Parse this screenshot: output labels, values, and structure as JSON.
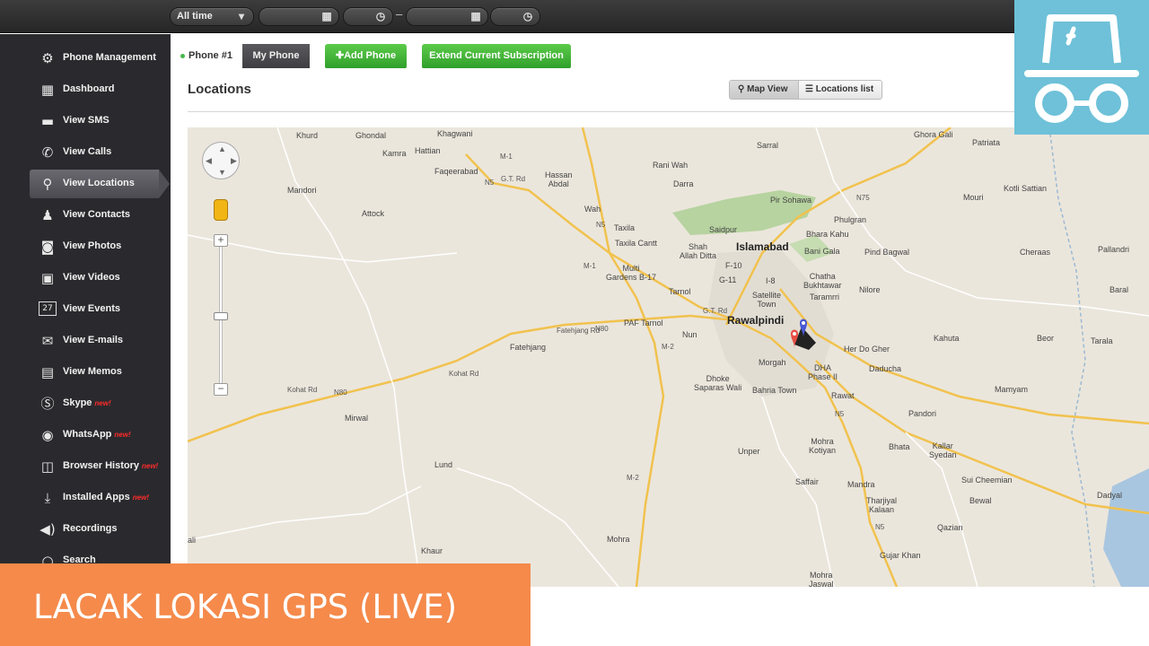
{
  "toolbar": {
    "period_select": "All time",
    "date_separator": "–"
  },
  "sidebar": {
    "items": [
      {
        "label": "Phone Management",
        "icon": "gear-icon"
      },
      {
        "label": "Dashboard",
        "icon": "grid-icon"
      },
      {
        "label": "View SMS",
        "icon": "chat-icon"
      },
      {
        "label": "View Calls",
        "icon": "phone-icon"
      },
      {
        "label": "View Locations",
        "icon": "map-pin-icon",
        "active": true
      },
      {
        "label": "View Contacts",
        "icon": "contacts-icon"
      },
      {
        "label": "View Photos",
        "icon": "camera-icon"
      },
      {
        "label": "View Videos",
        "icon": "video-icon"
      },
      {
        "label": "View Events",
        "icon": "calendar-icon",
        "icon_text": "27"
      },
      {
        "label": "View E-mails",
        "icon": "envelope-icon"
      },
      {
        "label": "View Memos",
        "icon": "memo-icon"
      },
      {
        "label": "Skype",
        "icon": "skype-icon",
        "badge": "new!"
      },
      {
        "label": "WhatsApp",
        "icon": "whatsapp-icon",
        "badge": "new!"
      },
      {
        "label": "Browser History",
        "icon": "browser-icon",
        "badge": "new!"
      },
      {
        "label": "Installed Apps",
        "icon": "download-icon",
        "badge": "new!"
      },
      {
        "label": "Recordings",
        "icon": "speaker-icon"
      },
      {
        "label": "Search",
        "icon": "search-icon"
      }
    ]
  },
  "tabs": {
    "phone1": "Phone #1",
    "myphone": "My Phone",
    "add_phone": "Add Phone",
    "extend": "Extend Current Subscription"
  },
  "page": {
    "title": "Locations",
    "map_view": "Map View",
    "locations_list": "Locations list"
  },
  "map_labels": {
    "khurd": "Khurd",
    "ghondal": "Ghondal",
    "khagwani": "Khagwani",
    "kamra": "Kamra",
    "hattian": "Hattian",
    "faqeerabad": "Faqeerabad",
    "gtrd1": "G.T. Rd",
    "hassan_abdal": "Hassan\nAbdal",
    "rani_wah": "Rani Wah",
    "darra": "Darra",
    "sarral": "Sarral",
    "ghora_gali": "Ghora Gali",
    "patriata": "Patriata",
    "kotli_sattian": "Kotli Sattian",
    "mouri": "Mouri",
    "mandori": "Mandori",
    "attock": "Attock",
    "wah": "Wah",
    "taxila": "Taxila",
    "taxila_cantt": "Taxila Cantt",
    "shah_allah_ditta": "Shah\nAllah Ditta",
    "saidpur": "Saidpur",
    "pir_sohawa": "Pir Sohawa",
    "phulgran": "Phulgran",
    "bhara_kahu": "Bhara Kahu",
    "bani_gala": "Bani Gala",
    "pind_bagwal": "Pind Bagwal",
    "cheraas": "Cheraas",
    "pallandri": "Pallandri",
    "islamabad": "Islamabad",
    "multi_gardens": "Multi\nGardens B-17",
    "f10": "F-10",
    "g11": "G-11",
    "i8": "I-8",
    "chatha_bukhtawar": "Chatha\nBukhtawar",
    "taramrri": "Taramrri",
    "nilore": "Nilore",
    "baral": "Baral",
    "tarnol": "Tarnol",
    "satellite_town": "Satellite\nTown",
    "gtrd2": "G.T. Rd",
    "fatehjang_rd": "Fatehjang Rd",
    "paf_tarnol": "PAF Tarnol",
    "rawalpindi": "Rawalpindi",
    "nun": "Nun",
    "fatehjang": "Fatehjang",
    "her_do_gher": "Her Do Gher",
    "kahuta": "Kahuta",
    "beor": "Beor",
    "tarala": "Tarala",
    "morgah": "Morgah",
    "dha": "DHA\nPhase II",
    "daducha": "Daducha",
    "kohat_rd": "Kohat Rd",
    "dhoke_saparas_wali": "Dhoke\nSaparas Wali",
    "bahria_town": "Bahria Town",
    "rawat": "Rawat",
    "mamyam": "Mamyam",
    "mirwal": "Mirwal",
    "pandori": "Pandori",
    "mohra_kotiyan": "Mohra\nKotiyan",
    "bhata": "Bhata",
    "kallar_syedan": "Kallar\nSyedan",
    "unper": "Unper",
    "lund": "Lund",
    "saffair": "Saffair",
    "mandra": "Mandra",
    "sui_cheemian": "Sui Cheemian",
    "dadyal": "Dadyal",
    "bewal": "Bewal",
    "tharjiyal_kalaan": "Tharjiyal\nKalaan",
    "qazian": "Qazian",
    "ali": "ali",
    "khaur": "Khaur",
    "mohra": "Mohra",
    "gujar_khan": "Gujar Khan",
    "mohra_jaswal": "Mohra\nJaswal",
    "kohat_rd2": "Kohat Rd",
    "m1": "M-1",
    "m1b": "M-1",
    "m2": "M-2",
    "m2b": "M-2",
    "n5": "N5",
    "n5b": "N5",
    "n5c": "N5",
    "n75": "N75",
    "n80": "N80",
    "n80b": "N80",
    "n5d": "N5"
  },
  "overlay": {
    "banner": "LACAK LOKASI GPS (LIVE)"
  },
  "colors": {
    "accent_green": "#3fb135",
    "banner_orange": "#f58a4b",
    "logo_blue": "#6ec1d8",
    "sidebar_bg": "#2a2a2e"
  }
}
